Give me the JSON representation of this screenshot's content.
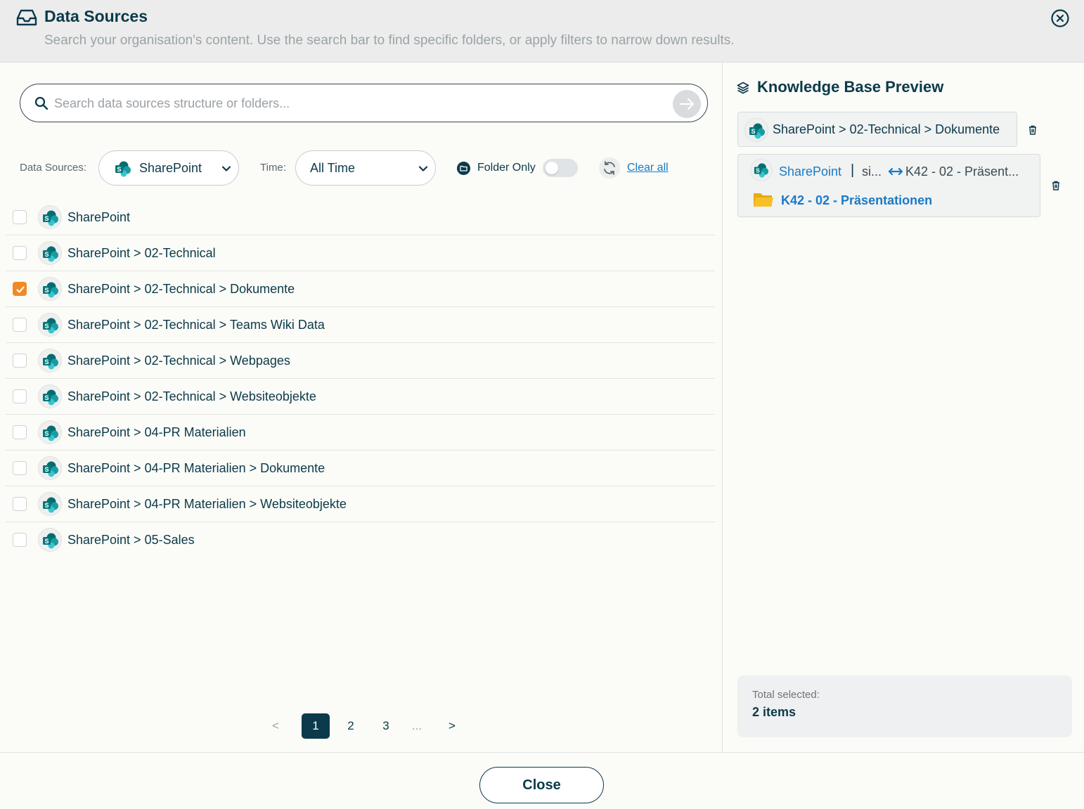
{
  "header": {
    "title": "Data Sources",
    "subtitle": "Search your organisation's content. Use the search bar to find specific folders, or apply filters to narrow down results."
  },
  "search": {
    "placeholder": "Search data sources structure or folders..."
  },
  "filters": {
    "data_sources_label": "Data Sources:",
    "data_sources_value": "SharePoint",
    "time_label": "Time:",
    "time_value": "All Time",
    "folder_only_label": "Folder Only",
    "folder_only_on": false,
    "clear_all_label": "Clear all"
  },
  "list": {
    "items": [
      {
        "label": "SharePoint",
        "checked": false
      },
      {
        "label": "SharePoint > 02-Technical",
        "checked": false
      },
      {
        "label": "SharePoint > 02-Technical > Dokumente",
        "checked": true
      },
      {
        "label": "SharePoint > 02-Technical > Teams Wiki Data",
        "checked": false
      },
      {
        "label": "SharePoint > 02-Technical > Webpages",
        "checked": false
      },
      {
        "label": "SharePoint > 02-Technical > Websiteobjekte",
        "checked": false
      },
      {
        "label": "SharePoint > 04-PR Materialien",
        "checked": false
      },
      {
        "label": "SharePoint > 04-PR Materialien > Dokumente",
        "checked": false
      },
      {
        "label": "SharePoint > 04-PR Materialien > Websiteobjekte",
        "checked": false
      },
      {
        "label": "SharePoint > 05-Sales",
        "checked": false
      }
    ]
  },
  "pagination": {
    "prev": "<",
    "pages": [
      "1",
      "2",
      "3"
    ],
    "ellipsis": "...",
    "next": ">",
    "current": "1"
  },
  "preview": {
    "title": "Knowledge Base Preview",
    "chip1": "SharePoint > 02-Technical > Dokumente",
    "chip2": {
      "source": "SharePoint",
      "separator": "|",
      "site": "si...",
      "target": "K42 - 02 - Präsent...",
      "folder": "K42 - 02 - Präsentationen"
    },
    "total_label": "Total selected:",
    "total_value": "2 items"
  },
  "footer": {
    "close_label": "Close"
  },
  "colors": {
    "primary": "#0b3a4a",
    "accent_orange": "#f08a24",
    "link_blue": "#1a7ac6",
    "folder_yellow": "#f6c02b"
  },
  "icons": [
    "inbox-icon",
    "close-circle-icon",
    "search-icon",
    "arrow-right-icon",
    "sharepoint-icon",
    "chevron-down-icon",
    "folder-icon",
    "refresh-icon",
    "layers-icon",
    "trash-icon",
    "swap-arrows-icon",
    "checkmark-icon"
  ]
}
